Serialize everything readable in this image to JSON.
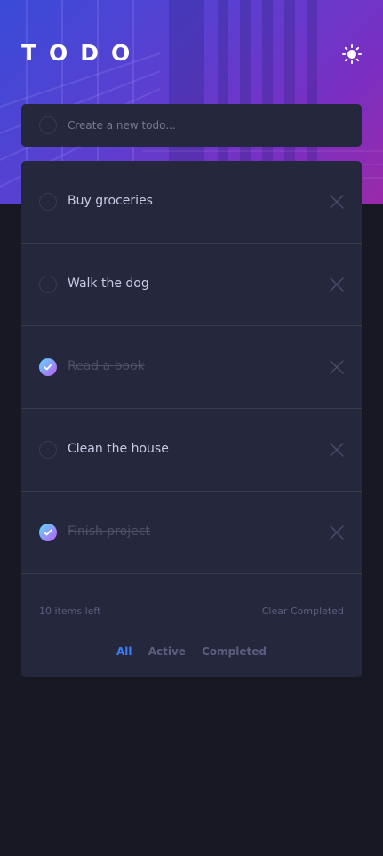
{
  "app": {
    "title": "TODO",
    "theme_toggle_icon": "sun-icon"
  },
  "new_todo": {
    "placeholder": "Create a new todo..."
  },
  "todos": [
    {
      "text": "Buy groceries",
      "completed": false
    },
    {
      "text": "Walk the dog",
      "completed": false
    },
    {
      "text": "Read a book",
      "completed": true
    },
    {
      "text": "Clean the house",
      "completed": false
    },
    {
      "text": "Finish project",
      "completed": true
    }
  ],
  "footer": {
    "items_left": "10 items left",
    "clear_completed": "Clear Completed"
  },
  "filters": [
    {
      "label": "All",
      "active": true
    },
    {
      "label": "Active",
      "active": false
    },
    {
      "label": "Completed",
      "active": false
    }
  ],
  "colors": {
    "background": "#181824",
    "card": "#25273c",
    "text": "#c8cbe7",
    "muted": "#5b5e7e",
    "accent": "#3a7cfd",
    "check_gradient_start": "#57ddff",
    "check_gradient_end": "#c058f3"
  }
}
